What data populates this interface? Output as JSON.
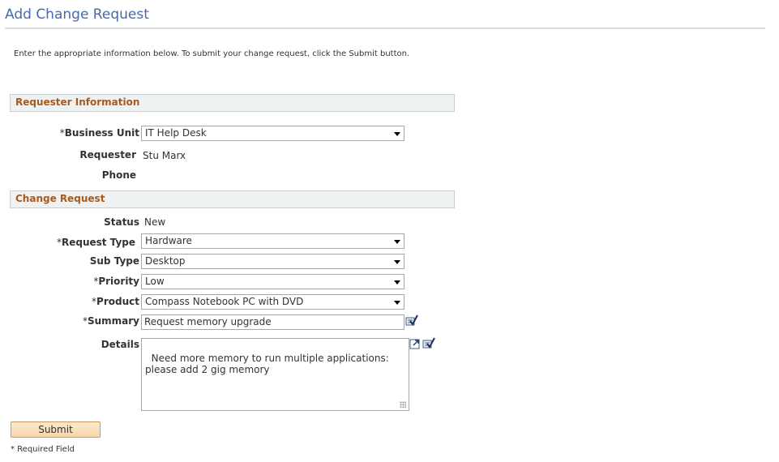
{
  "page": {
    "title": "Add Change Request",
    "instructions": "Enter the appropriate information below.  To submit your change request, click the Submit button.",
    "required_note": "* Required Field"
  },
  "requester_section": {
    "header": "Requester Information",
    "business_unit": {
      "label": "Business Unit",
      "required": "*",
      "value": "IT Help Desk"
    },
    "requester": {
      "label": "Requester",
      "value": "Stu Marx"
    },
    "phone": {
      "label": "Phone",
      "value": ""
    }
  },
  "change_section": {
    "header": "Change Request",
    "status": {
      "label": "Status",
      "value": "New"
    },
    "request_type": {
      "label": "Request Type",
      "required": "*",
      "value": "Hardware"
    },
    "sub_type": {
      "label": "Sub Type",
      "value": "Desktop"
    },
    "priority": {
      "label": "Priority",
      "required": "*",
      "value": "Low"
    },
    "product": {
      "label": "Product",
      "required": "*",
      "value": "Compass Notebook PC with DVD"
    },
    "summary": {
      "label": "Summary",
      "required": "*",
      "value": "Request memory upgrade"
    },
    "details": {
      "label": "Details",
      "value": "Need more memory to run multiple applications: please add 2 gig memory"
    }
  },
  "actions": {
    "submit_label": "Submit"
  },
  "icons": {
    "spell_check": "spell-check-icon",
    "expand": "expand-icon"
  },
  "colors": {
    "title": "#4a6aa5",
    "section_header_text": "#a85a1c",
    "section_header_bg": "#eef2f2",
    "button_bg": "#f7d7a8"
  }
}
